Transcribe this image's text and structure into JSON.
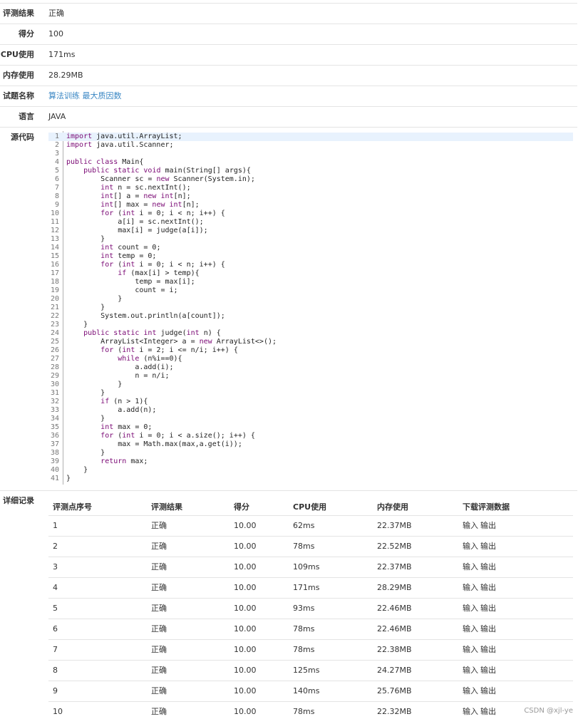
{
  "info": {
    "result_label": "评测结果",
    "result_value": "正确",
    "score_label": "得分",
    "score_value": "100",
    "cpu_label": "CPU使用",
    "cpu_value": "171ms",
    "mem_label": "内存使用",
    "mem_value": "28.29MB",
    "problem_label": "试题名称",
    "problem_value": "算法训练 最大质因数",
    "lang_label": "语言",
    "lang_value": "JAVA",
    "source_label": "源代码"
  },
  "code_lines": [
    "import java.util.ArrayList;",
    "import java.util.Scanner;",
    "",
    "public class Main{",
    "    public static void main(String[] args){",
    "        Scanner sc = new Scanner(System.in);",
    "        int n = sc.nextInt();",
    "        int[] a = new int[n];",
    "        int[] max = new int[n];",
    "        for (int i = 0; i < n; i++) {",
    "            a[i] = sc.nextInt();",
    "            max[i] = judge(a[i]);",
    "        }",
    "        int count = 0;",
    "        int temp = 0;",
    "        for (int i = 0; i < n; i++) {",
    "            if (max[i] > temp){",
    "                temp = max[i];",
    "                count = i;",
    "            }",
    "        }",
    "        System.out.println(a[count]);",
    "    }",
    "    public static int judge(int n) {",
    "        ArrayList<Integer> a = new ArrayList<>();",
    "        for (int i = 2; i <= n/i; i++) {",
    "            while (n%i==0){",
    "                a.add(i);",
    "                n = n/i;",
    "            }",
    "        }",
    "        if (n > 1){",
    "            a.add(n);",
    "        }",
    "        int max = 0;",
    "        for (int i = 0; i < a.size(); i++) {",
    "            max = Math.max(max,a.get(i));",
    "        }",
    "        return max;",
    "    }",
    "}"
  ],
  "details": {
    "label": "详细记录",
    "headers": [
      "评测点序号",
      "评测结果",
      "得分",
      "CPU使用",
      "内存使用",
      "下载评测数据"
    ],
    "input_link": "输入",
    "output_link": "输出",
    "rows": [
      {
        "no": "1",
        "result": "正确",
        "score": "10.00",
        "cpu": "62ms",
        "mem": "22.37MB"
      },
      {
        "no": "2",
        "result": "正确",
        "score": "10.00",
        "cpu": "78ms",
        "mem": "22.52MB"
      },
      {
        "no": "3",
        "result": "正确",
        "score": "10.00",
        "cpu": "109ms",
        "mem": "22.37MB"
      },
      {
        "no": "4",
        "result": "正确",
        "score": "10.00",
        "cpu": "171ms",
        "mem": "28.29MB"
      },
      {
        "no": "5",
        "result": "正确",
        "score": "10.00",
        "cpu": "93ms",
        "mem": "22.46MB"
      },
      {
        "no": "6",
        "result": "正确",
        "score": "10.00",
        "cpu": "78ms",
        "mem": "22.46MB"
      },
      {
        "no": "7",
        "result": "正确",
        "score": "10.00",
        "cpu": "78ms",
        "mem": "22.38MB"
      },
      {
        "no": "8",
        "result": "正确",
        "score": "10.00",
        "cpu": "125ms",
        "mem": "24.27MB"
      },
      {
        "no": "9",
        "result": "正确",
        "score": "10.00",
        "cpu": "140ms",
        "mem": "25.76MB"
      },
      {
        "no": "10",
        "result": "正确",
        "score": "10.00",
        "cpu": "78ms",
        "mem": "22.32MB"
      }
    ]
  },
  "watermark": "CSDN @xjl-ye",
  "colors": {
    "link": "#3a87c4",
    "highlight": "#e8f2fd",
    "border": "#e4e4e4"
  }
}
